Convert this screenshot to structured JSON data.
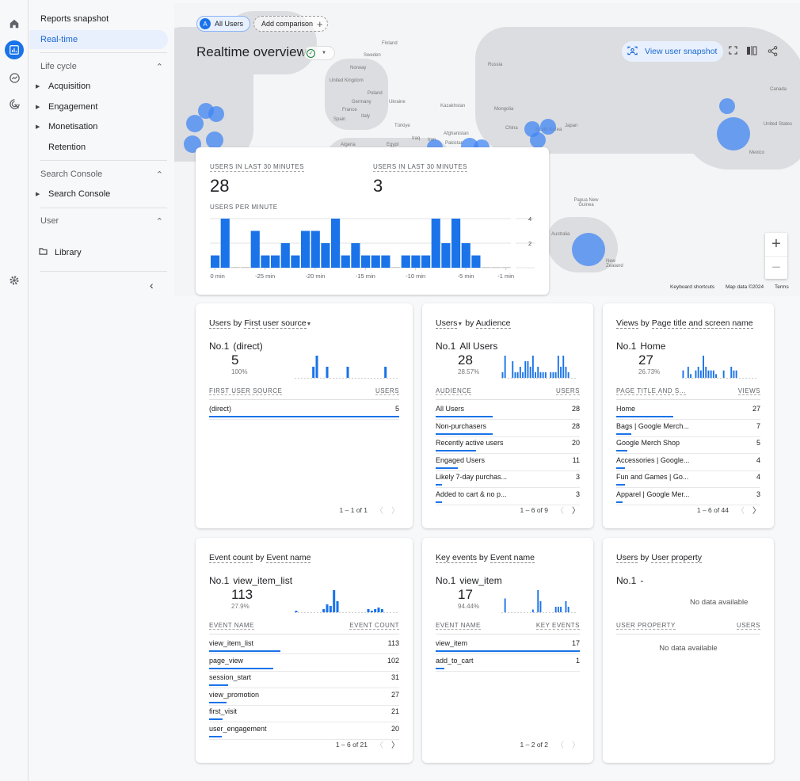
{
  "rail": {
    "icons": [
      "home-icon",
      "reports-icon",
      "explore-icon",
      "advertising-icon"
    ],
    "settings_icon": "gear-icon"
  },
  "nav": {
    "reports_snapshot": "Reports snapshot",
    "realtime": "Real-time",
    "sections": [
      {
        "label": "Life cycle",
        "items": [
          "Acquisition",
          "Engagement",
          "Monetisation"
        ],
        "plain_items": [
          "Retention"
        ]
      },
      {
        "label": "Search Console",
        "items": [
          "Search Console"
        ]
      },
      {
        "label": "User",
        "library": "Library"
      }
    ],
    "collapse_icon": "chevron-left-icon"
  },
  "header": {
    "segment_badge": "A",
    "segment_label": "All Users",
    "add_comparison": "Add comparison",
    "title": "Realtime overview",
    "view_user_snapshot": "View user snapshot"
  },
  "map": {
    "labels": [
      "Finland",
      "Sweden",
      "Norway",
      "United Kingdom",
      "Poland",
      "Germany",
      "Ukraine",
      "France",
      "Spain",
      "Italy",
      "Türkiye",
      "Kazakhstan",
      "Mongolia",
      "China",
      "South Korea",
      "Japan",
      "Russia",
      "Iraq",
      "Iran",
      "Afghanistan",
      "Pakistan",
      "Algeria",
      "Egypt",
      "Canada",
      "United States",
      "Mexico",
      "Papua New Guinea",
      "Australia",
      "New Zealand"
    ],
    "footer": {
      "shortcuts": "Keyboard shortcuts",
      "data": "Map data ©2024",
      "terms": "Terms"
    },
    "zoom_in": "+",
    "zoom_out": "−"
  },
  "realtime_card": {
    "kpi1_label": "USERS IN LAST 30 MINUTES",
    "kpi1_value": "28",
    "kpi2_label": "USERS IN LAST 30 MINUTES",
    "kpi2_value": "3",
    "chart_label": "USERS PER MINUTE"
  },
  "chart_data": {
    "type": "bar",
    "title": "USERS PER MINUTE",
    "x": [
      -30,
      -29,
      -28,
      -27,
      -26,
      -25,
      -24,
      -23,
      -22,
      -21,
      -20,
      -19,
      -18,
      -17,
      -16,
      -15,
      -14,
      -13,
      -12,
      -11,
      -10,
      -9,
      -8,
      -7,
      -6,
      -5,
      -4,
      -3,
      -2,
      -1
    ],
    "values": [
      1,
      4,
      0,
      0,
      3,
      1,
      1,
      2,
      1,
      3,
      3,
      2,
      4,
      1,
      2,
      1,
      1,
      1,
      0,
      1,
      1,
      1,
      4,
      2,
      4,
      2,
      1,
      0,
      0,
      0
    ],
    "xtick_labels": [
      "-30 min",
      "-25 min",
      "-20 min",
      "-15 min",
      "-10 min",
      "-5 min",
      "-1 min"
    ],
    "ytick_labels": [
      "2",
      "4"
    ],
    "ylim": [
      0,
      4
    ],
    "grid": true
  },
  "cards": [
    {
      "title_parts": [
        "Users",
        " by ",
        "First user source"
      ],
      "title_dropdown": "second",
      "top_label": "No.1",
      "top_name": "(direct)",
      "value": "5",
      "percent": "100%",
      "col1": "FIRST USER SOURCE",
      "col2": "USERS",
      "rows": [
        {
          "name": "(direct)",
          "value": "5",
          "share": 1.0
        }
      ],
      "spark": [
        0,
        0,
        0,
        0,
        0,
        1,
        2,
        0,
        0,
        1,
        0,
        0,
        0,
        0,
        0,
        1,
        0,
        0,
        0,
        0,
        0,
        0,
        0,
        0,
        0,
        0,
        1,
        0,
        0,
        0
      ],
      "pager": "1 – 1 of 1",
      "next_enabled": false
    },
    {
      "title_parts": [
        "Users",
        " by ",
        "Audience"
      ],
      "title_dropdown": "first",
      "top_label": "No.1",
      "top_name": "All Users",
      "value": "28",
      "percent": "28.57%",
      "col1": "AUDIENCE",
      "col2": "USERS",
      "rows": [
        {
          "name": "All Users",
          "value": "28",
          "share": 1.0
        },
        {
          "name": "Non-purchasers",
          "value": "28",
          "share": 1.0
        },
        {
          "name": "Recently active users",
          "value": "20",
          "share": 0.71
        },
        {
          "name": "Engaged Users",
          "value": "11",
          "share": 0.39
        },
        {
          "name": "Likely 7-day purchas...",
          "value": "3",
          "share": 0.11
        },
        {
          "name": "Added to cart & no p...",
          "value": "3",
          "share": 0.11
        }
      ],
      "spark": [
        1,
        4,
        0,
        0,
        3,
        1,
        1,
        2,
        1,
        3,
        3,
        2,
        4,
        1,
        2,
        1,
        1,
        1,
        0,
        1,
        1,
        1,
        4,
        2,
        4,
        2,
        1,
        0,
        0,
        0
      ],
      "pager": "1 – 6 of 9",
      "next_enabled": true
    },
    {
      "title_parts": [
        "Views",
        " by ",
        "Page title and screen name"
      ],
      "title_dropdown": "none",
      "top_label": "No.1",
      "top_name": "Home",
      "value": "27",
      "percent": "26.73%",
      "col1": "PAGE TITLE AND S...",
      "col2": "VIEWS",
      "rows": [
        {
          "name": "Home",
          "value": "27",
          "share": 1.0
        },
        {
          "name": "Bags | Google Merch...",
          "value": "7",
          "share": 0.26
        },
        {
          "name": "Google Merch Shop",
          "value": "5",
          "share": 0.19
        },
        {
          "name": "Accessories | Google...",
          "value": "4",
          "share": 0.15
        },
        {
          "name": "Fun and Games | Go...",
          "value": "4",
          "share": 0.15
        },
        {
          "name": "Apparel | Google Mer...",
          "value": "3",
          "share": 0.11
        }
      ],
      "spark": [
        2,
        0,
        3,
        1,
        0,
        2,
        3,
        2,
        6,
        3,
        2,
        2,
        2,
        1,
        0,
        0,
        2,
        0,
        0,
        3,
        2,
        2,
        0,
        0,
        0,
        0,
        0,
        0,
        0,
        0
      ],
      "pager": "1 – 6 of 44",
      "next_enabled": true
    },
    {
      "title_parts": [
        "Event count",
        " by ",
        "Event name"
      ],
      "title_dropdown": "none",
      "top_label": "No.1",
      "top_name": "view_item_list",
      "value": "113",
      "percent": "27.9%",
      "col1": "EVENT NAME",
      "col2": "EVENT COUNT",
      "rows": [
        {
          "name": "view_item_list",
          "value": "113",
          "share": 1.0
        },
        {
          "name": "page_view",
          "value": "102",
          "share": 0.9
        },
        {
          "name": "session_start",
          "value": "31",
          "share": 0.27
        },
        {
          "name": "view_promotion",
          "value": "27",
          "share": 0.24
        },
        {
          "name": "first_visit",
          "value": "21",
          "share": 0.19
        },
        {
          "name": "user_engagement",
          "value": "20",
          "share": 0.18
        }
      ],
      "spark": [
        1,
        0,
        0,
        0,
        0,
        0,
        0,
        0,
        2,
        5,
        4,
        14,
        7,
        0,
        0,
        0,
        0,
        0,
        0,
        0,
        0,
        2,
        1,
        2,
        3,
        2,
        0,
        0,
        0,
        0
      ],
      "pager": "1 – 6 of 21",
      "next_enabled": true
    },
    {
      "title_parts": [
        "Key events",
        " by ",
        "Event name"
      ],
      "title_dropdown": "none",
      "top_label": "No.1",
      "top_name": "view_item",
      "value": "17",
      "percent": "94.44%",
      "col1": "EVENT NAME",
      "col2": "KEY EVENTS",
      "rows": [
        {
          "name": "view_item",
          "value": "17",
          "share": 1.0
        },
        {
          "name": "add_to_cart",
          "value": "1",
          "share": 0.06
        }
      ],
      "spark": [
        0,
        5,
        0,
        0,
        0,
        0,
        0,
        0,
        0,
        0,
        0,
        0,
        1,
        0,
        8,
        4,
        0,
        0,
        0,
        0,
        0,
        2,
        2,
        2,
        0,
        4,
        2,
        0,
        0,
        0
      ],
      "pager": "1 – 2 of 2",
      "next_enabled": false
    },
    {
      "title_parts": [
        "Users",
        " by ",
        "User property"
      ],
      "title_dropdown": "none",
      "top_label": "No.1",
      "top_name": "-",
      "no_data_chart": "No data available",
      "col1": "USER PROPERTY",
      "col2": "USERS",
      "no_data_table": "No data available"
    }
  ]
}
